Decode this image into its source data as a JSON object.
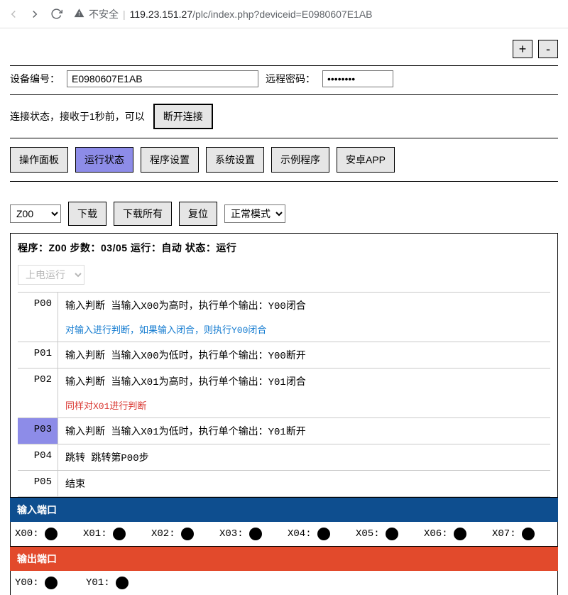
{
  "browser": {
    "sec_label": "不安全",
    "host": "119.23.151.27",
    "path": "/plc/index.php?deviceid=E0980607E1AB"
  },
  "topright": {
    "plus": "+",
    "minus": "-"
  },
  "device": {
    "id_label": "设备编号：",
    "id_value": "E0980607E1AB",
    "pwd_label": "远程密码：",
    "pwd_value": "••••••••"
  },
  "conn": {
    "status_text": "连接状态，接收于1秒前，可以",
    "disconnect_btn": "断开连接"
  },
  "nav": {
    "items": [
      "操作面板",
      "运行状态",
      "程序设置",
      "系统设置",
      "示例程序",
      "安卓APP"
    ],
    "active_index": 1
  },
  "toolbar": {
    "zone_value": "Z00",
    "download": "下载",
    "download_all": "下载所有",
    "reset": "复位",
    "mode_value": "正常模式"
  },
  "program": {
    "header": "程序：Z00  步数：03/05   运行：自动   状态：运行",
    "bootsel": "上电运行",
    "steps": [
      {
        "id": "P00",
        "text": "输入判断  当输入X00为高时，执行单个输出：Y00闭合",
        "note": "对输入进行判断，如果输入闭合，则执行Y00闭合",
        "note_kind": "blue"
      },
      {
        "id": "P01",
        "text": "输入判断  当输入X00为低时，执行单个输出：Y00断开"
      },
      {
        "id": "P02",
        "text": "输入判断  当输入X01为高时，执行单个输出：Y01闭合",
        "note": "同样对X01进行判断",
        "note_kind": "red"
      },
      {
        "id": "P03",
        "text": "输入判断  当输入X01为低时，执行单个输出：Y01断开",
        "highlight": true
      },
      {
        "id": "P04",
        "text": "跳转  跳转第P00步"
      },
      {
        "id": "P05",
        "text": "结束"
      }
    ]
  },
  "ports": {
    "in_header": "输入端口",
    "in": [
      "X00:",
      "X01:",
      "X02:",
      "X03:",
      "X04:",
      "X05:",
      "X06:",
      "X07:"
    ],
    "out_header": "输出端口",
    "out": [
      "Y00:",
      "Y01:"
    ]
  }
}
